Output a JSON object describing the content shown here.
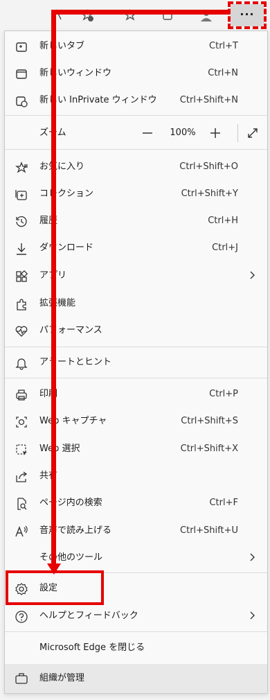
{
  "toolbar": {
    "more_button": "···"
  },
  "menu": {
    "new_tab": {
      "label": "新しいタブ",
      "shortcut": "Ctrl+T"
    },
    "new_window": {
      "label": "新しいウィンドウ",
      "shortcut": "Ctrl+N"
    },
    "new_inprivate": {
      "label": "新しい InPrivate ウィンドウ",
      "shortcut": "Ctrl+Shift+N"
    },
    "zoom": {
      "label": "ズーム",
      "value": "100%",
      "minus": "—",
      "plus": "+"
    },
    "favorites": {
      "label": "お気に入り",
      "shortcut": "Ctrl+Shift+O"
    },
    "collections": {
      "label": "コレクション",
      "shortcut": "Ctrl+Shift+Y"
    },
    "history": {
      "label": "履歴",
      "shortcut": "Ctrl+H"
    },
    "downloads": {
      "label": "ダウンロード",
      "shortcut": "Ctrl+J"
    },
    "apps": {
      "label": "アプリ"
    },
    "extensions": {
      "label": "拡張機能"
    },
    "performance": {
      "label": "パフォーマンス"
    },
    "alerts": {
      "label": "アラートとヒント"
    },
    "print": {
      "label": "印刷",
      "shortcut": "Ctrl+P"
    },
    "web_capture": {
      "label": "Web キャプチャ",
      "shortcut": "Ctrl+Shift+S"
    },
    "web_select": {
      "label": "Web 選択",
      "shortcut": "Ctrl+Shift+X"
    },
    "share": {
      "label": "共有"
    },
    "find": {
      "label": "ページ内の検索",
      "shortcut": "Ctrl+F"
    },
    "read_aloud": {
      "label": "音声で読み上げる",
      "shortcut": "Ctrl+Shift+U"
    },
    "more_tools": {
      "label": "その他のツール"
    },
    "settings": {
      "label": "設定"
    },
    "help": {
      "label": "ヘルプとフィードバック"
    },
    "close_edge": {
      "label": "Microsoft Edge を閉じる"
    },
    "managed": {
      "label": "組織が管理"
    }
  },
  "colors": {
    "annotation": "#e60000"
  }
}
